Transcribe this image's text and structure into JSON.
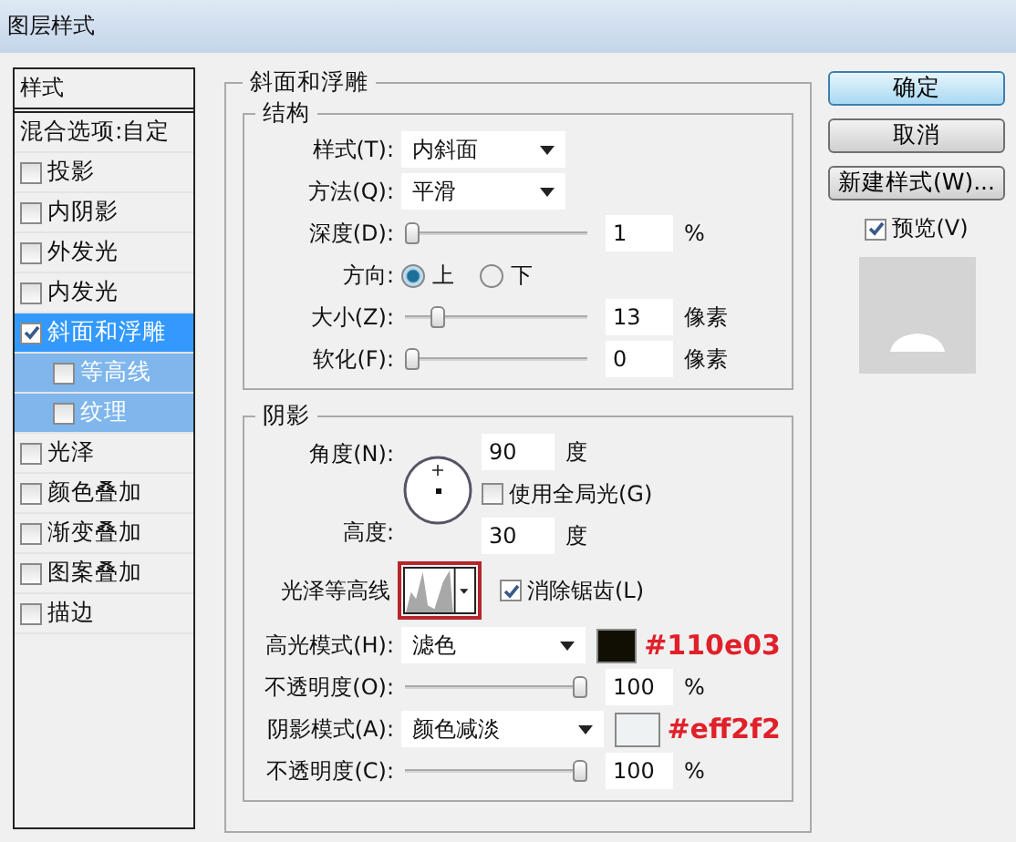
{
  "window": {
    "title": "图层样式"
  },
  "styles_panel": {
    "header": "样式",
    "blend_options": "混合选项:自定",
    "items": [
      {
        "label": "投影",
        "checked": false,
        "selected": false
      },
      {
        "label": "内阴影",
        "checked": false,
        "selected": false
      },
      {
        "label": "外发光",
        "checked": false,
        "selected": false
      },
      {
        "label": "内发光",
        "checked": false,
        "selected": false
      },
      {
        "label": "斜面和浮雕",
        "checked": true,
        "selected": true,
        "children": [
          {
            "label": "等高线",
            "checked": false,
            "selected": false
          },
          {
            "label": "纹理",
            "checked": false,
            "selected": false
          }
        ]
      },
      {
        "label": "光泽",
        "checked": false,
        "selected": false
      },
      {
        "label": "颜色叠加",
        "checked": false,
        "selected": false
      },
      {
        "label": "渐变叠加",
        "checked": false,
        "selected": false
      },
      {
        "label": "图案叠加",
        "checked": false,
        "selected": false
      },
      {
        "label": "描边",
        "checked": false,
        "selected": false
      }
    ]
  },
  "bevel": {
    "title": "斜面和浮雕",
    "structure": {
      "title": "结构",
      "rows": [
        {
          "kind": "select",
          "label": "样式(T):",
          "value": "内斜面"
        },
        {
          "kind": "select",
          "label": "方法(Q):",
          "value": "平滑"
        },
        {
          "kind": "slider",
          "label": "深度(D):",
          "level": 0,
          "value": "1",
          "unit": "%"
        },
        {
          "kind": "radio",
          "label": "方向:",
          "options": [
            {
              "label": "上",
              "selected": true
            },
            {
              "label": "下",
              "selected": false
            }
          ]
        },
        {
          "kind": "slider",
          "label": "大小(Z):",
          "level": 0.15,
          "value": "13",
          "unit": "像素"
        },
        {
          "kind": "slider",
          "label": "软化(F):",
          "level": 0,
          "value": "0",
          "unit": "像素"
        }
      ]
    },
    "shading": {
      "title": "阴影",
      "angle": {
        "label": "角度(N):",
        "value": "90",
        "unit": "度"
      },
      "global_light": {
        "label": "使用全局光(G)",
        "checked": false
      },
      "altitude": {
        "label": "高度:",
        "value": "30",
        "unit": "度"
      },
      "gloss_contour": {
        "label": "光泽等高线",
        "annotated": true
      },
      "anti_alias": {
        "label": "消除锯齿(L)",
        "checked": true
      },
      "rows": [
        {
          "kind": "mode",
          "label": "高光模式(H):",
          "value": "滤色",
          "color": "#110e03",
          "note": "#110e03"
        },
        {
          "kind": "slider",
          "label": "不透明度(O):",
          "level": 1,
          "value": "100",
          "unit": "%"
        },
        {
          "kind": "mode",
          "label": "阴影模式(A):",
          "value": "颜色减淡",
          "color": "#eff2f2",
          "note": "#eff2f2"
        },
        {
          "kind": "slider",
          "label": "不透明度(C):",
          "level": 1,
          "value": "100",
          "unit": "%"
        }
      ]
    }
  },
  "buttons": [
    {
      "label": "确定",
      "default": true
    },
    {
      "label": "取消",
      "default": false
    },
    {
      "label": "新建样式(W)...",
      "default": false
    }
  ],
  "preview": {
    "label": "预览(V)",
    "checked": true
  }
}
